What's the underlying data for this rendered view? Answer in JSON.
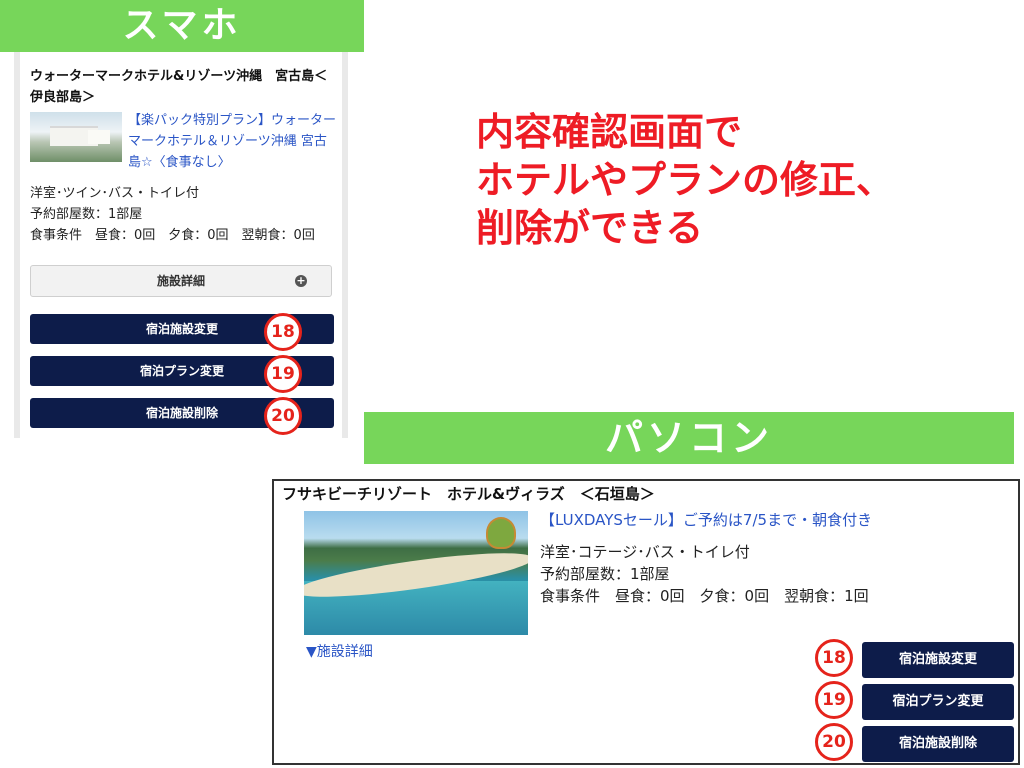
{
  "sp": {
    "banner": "スマホ",
    "hotel_name": "ウォーターマークホテル&リゾーツ沖縄　宮古島＜伊良部島＞",
    "plan_link": "【楽パック特別プラン】ウォーターマークホテル＆リゾーツ沖縄 宮古島☆〈食事なし〉",
    "room_type": "洋室･ツイン･バス・トイレ付",
    "rooms": "予約部屋数：1部屋",
    "meals": "食事条件　昼食：0回　夕食：0回　翌朝食：0回",
    "detail_label": "施設詳細",
    "detail_icon": "+",
    "buttons": {
      "change_facility": "宿泊施設変更",
      "change_plan": "宿泊プラン変更",
      "delete_facility": "宿泊施設削除"
    }
  },
  "markers": {
    "m18": "18",
    "m19": "19",
    "m20": "20"
  },
  "caption": {
    "line1": "内容確認画面で",
    "line2": "ホテルやプランの修正、",
    "line3": "削除ができる"
  },
  "pc": {
    "banner": "パソコン",
    "hotel_name": "フサキビーチリゾート　ホテル&ヴィラズ　＜石垣島＞",
    "plan_link": "【LUXDAYSセール】ご予約は7/5まで・朝食付き",
    "room_type": "洋室･コテージ･バス・トイレ付",
    "rooms": "予約部屋数：1部屋",
    "meals": "食事条件　昼食：0回　夕食：0回　翌朝食：1回",
    "detail_link": "▼施設詳細",
    "buttons": {
      "change_facility": "宿泊施設変更",
      "change_plan": "宿泊プラン変更",
      "delete_facility": "宿泊施設削除"
    }
  },
  "colors": {
    "banner_green": "#77d65a",
    "button_navy": "#0d1c4a",
    "caption_red": "#ee1c25",
    "link_blue": "#2a55c6"
  }
}
